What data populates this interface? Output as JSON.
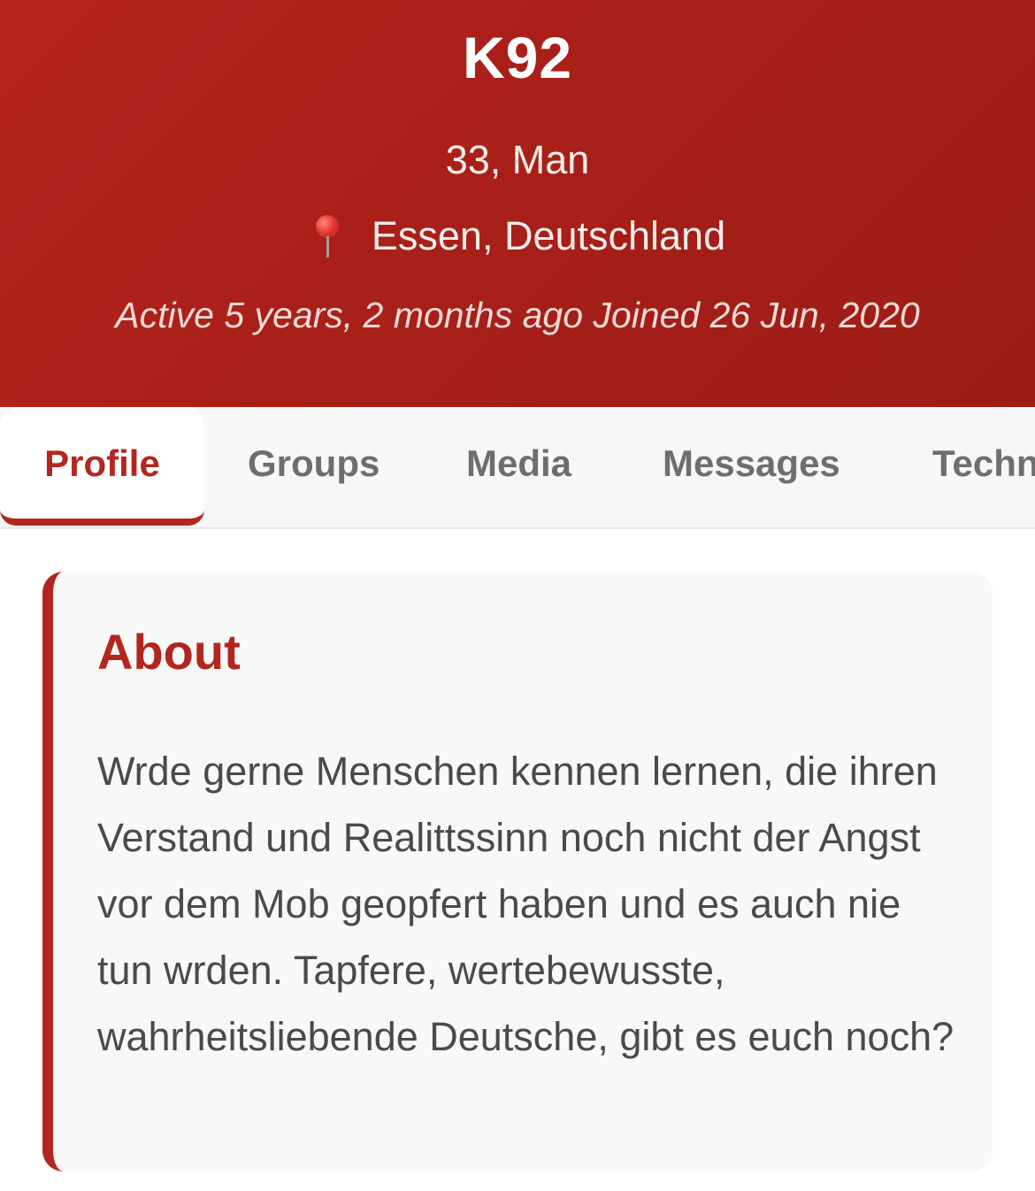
{
  "profile": {
    "username": "K92",
    "age_gender": "33, Man",
    "location": "Essen, Deutschland",
    "location_icon": "round-pushpin-icon",
    "activity": "Active 5 years, 2 months ago Joined 26 Jun, 2020"
  },
  "tabs": [
    {
      "label": "Profile",
      "active": true
    },
    {
      "label": "Groups",
      "active": false
    },
    {
      "label": "Media",
      "active": false
    },
    {
      "label": "Messages",
      "active": false
    },
    {
      "label": "Techn",
      "active": false
    }
  ],
  "about": {
    "title": "About",
    "text": "Wrde gerne Menschen kennen lernen, die ihren Verstand und Realittssinn noch nicht der Angst vor dem Mob geopfert haben und es auch nie tun wrden. Tapfere, wertebewusste, wahrheitsliebende Deutsche, gibt es euch noch?"
  },
  "colors": {
    "brand_red": "#b3261e",
    "header_bg": "#a61f18",
    "tab_inactive": "#6e6e6e",
    "body_text": "#4a4a4a"
  }
}
